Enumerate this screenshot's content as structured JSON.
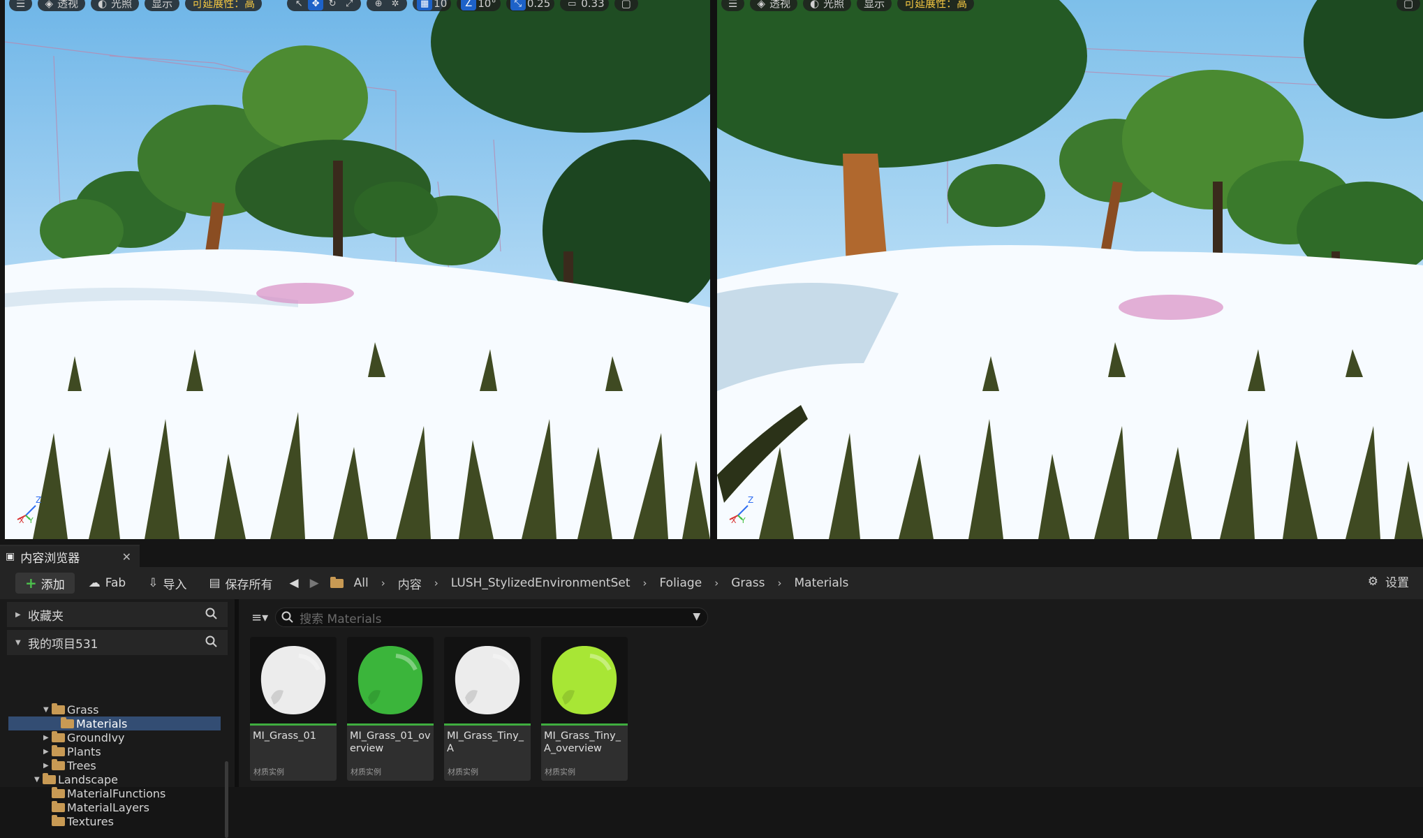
{
  "viewport_toolbar": {
    "menu_icon": "hamburger-menu-icon",
    "perspective": "透视",
    "lit": "光照",
    "show": "显示",
    "scalability": "可延展性：高",
    "grid_snap": "10",
    "angle_snap": "10°",
    "scale_snap": "0.25",
    "camera_speed": "0.33"
  },
  "viewport_toolbar_right": {
    "perspective": "透视",
    "lit": "光照",
    "show": "显示",
    "scalability": "可延展性：高"
  },
  "content_browser": {
    "tab_title": "内容浏览器",
    "toolbar": {
      "add": "添加",
      "fab": "Fab",
      "import": "导入",
      "save_all": "保存所有",
      "settings": "设置"
    },
    "breadcrumbs": [
      "All",
      "内容",
      "LUSH_StylizedEnvironmentSet",
      "Foliage",
      "Grass",
      "Materials"
    ],
    "sidebar": {
      "favorites": "收藏夹",
      "project": "我的项目531",
      "tree": [
        {
          "label": "Grass",
          "indent": 2,
          "expanded": true
        },
        {
          "label": "Materials",
          "indent": 3,
          "selected": true
        },
        {
          "label": "GroundIvy",
          "indent": 2
        },
        {
          "label": "Plants",
          "indent": 2
        },
        {
          "label": "Trees",
          "indent": 2
        },
        {
          "label": "Landscape",
          "indent": 1,
          "expanded": true
        },
        {
          "label": "MaterialFunctions",
          "indent": 2
        },
        {
          "label": "MaterialLayers",
          "indent": 2
        },
        {
          "label": "Textures",
          "indent": 2
        }
      ]
    },
    "search_placeholder": "搜索 Materials",
    "assets": [
      {
        "name": "MI_Grass_01",
        "type": "材质实例",
        "color": "#ececec",
        "checker": false
      },
      {
        "name": "MI_Grass_01_overview",
        "type": "材质实例",
        "color": "#3bb53b",
        "checker": false
      },
      {
        "name": "MI_Grass_Tiny_A",
        "type": "材质实例",
        "color": "#ececec",
        "checker": false
      },
      {
        "name": "MI_Grass_Tiny_A_overview",
        "type": "材质实例",
        "color": "#a8e635",
        "checker": true
      }
    ]
  }
}
